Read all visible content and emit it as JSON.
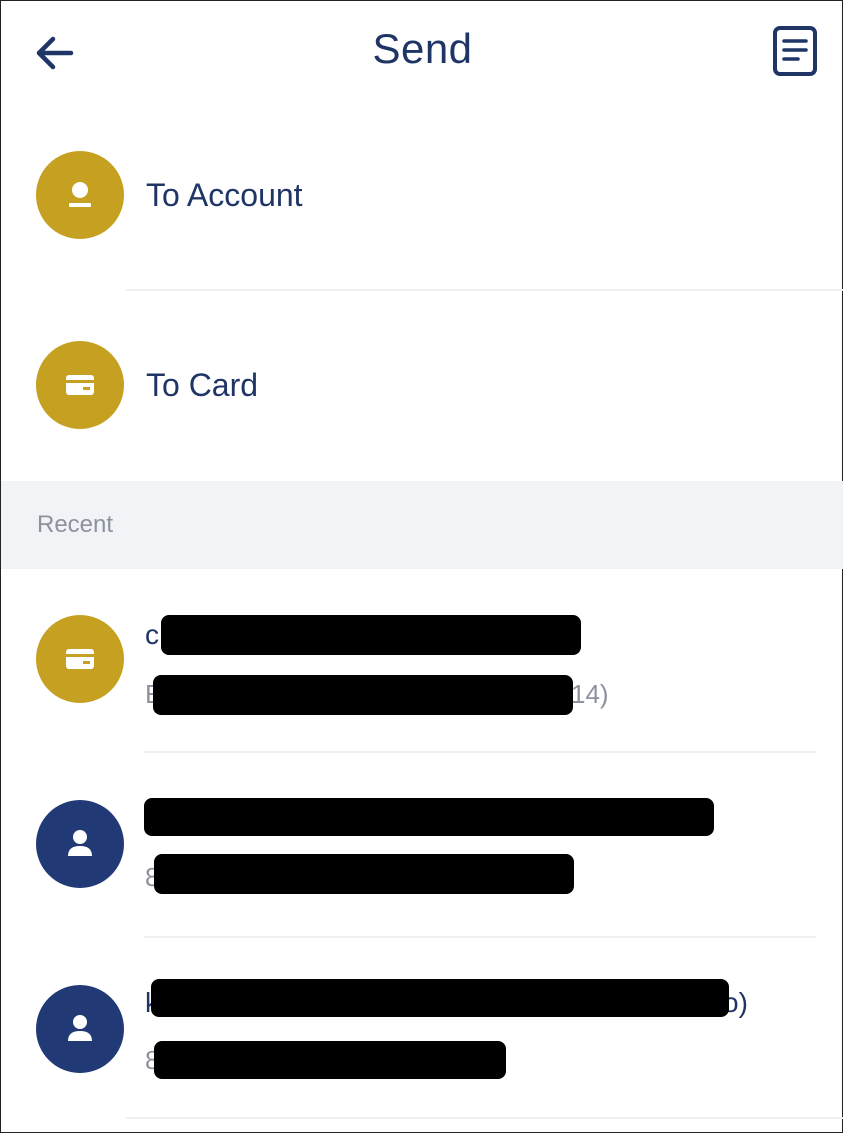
{
  "header": {
    "title": "Send",
    "back_icon": "arrow-left-icon",
    "history_icon": "document-list-icon"
  },
  "options": [
    {
      "label": "To Account",
      "icon": "account-icon",
      "color": "#c6a020"
    },
    {
      "label": "To Card",
      "icon": "card-icon",
      "color": "#c6a020"
    }
  ],
  "recent": {
    "label": "Recent",
    "items": [
      {
        "name_visible": "c",
        "sub_visible_start": "E",
        "sub_visible_end": "14)",
        "icon": "card-icon",
        "color": "#c6a020"
      },
      {
        "name_visible": "",
        "sub_visible_start": "8",
        "sub_visible_end": "",
        "icon": "person-icon",
        "color": "#213a76"
      },
      {
        "name_visible": "k",
        "name_visible_end": "o)",
        "sub_visible_start": "8",
        "sub_visible_end": "",
        "icon": "person-icon",
        "color": "#213a76"
      }
    ]
  },
  "colors": {
    "accent_gold": "#c6a020",
    "accent_navy": "#213a76",
    "text_dark": "#1f3566",
    "text_muted": "#8d929e",
    "section_bg": "#f2f3f7"
  }
}
